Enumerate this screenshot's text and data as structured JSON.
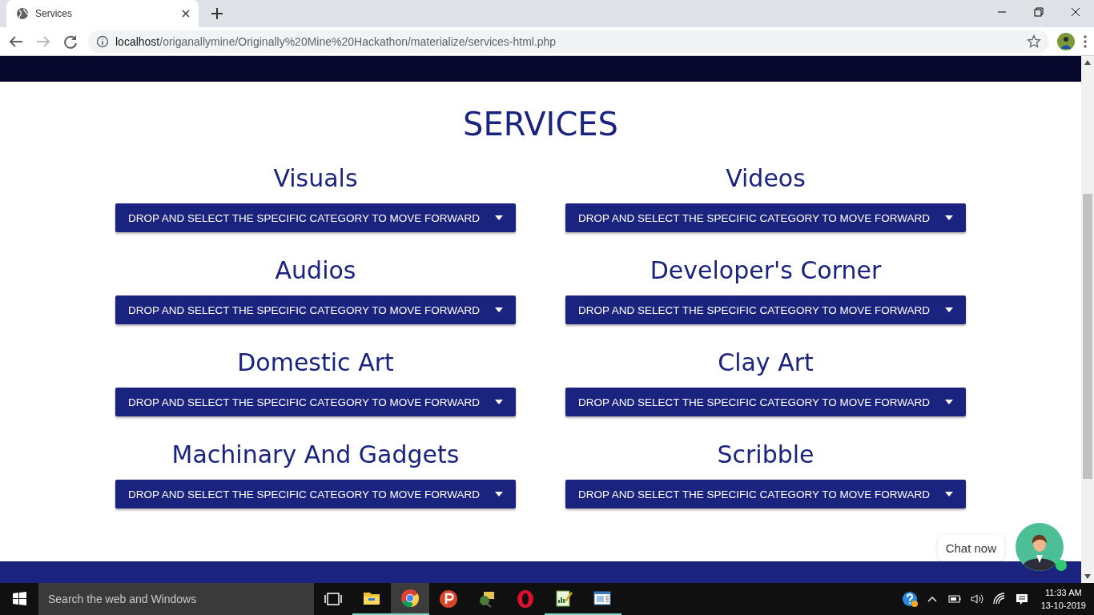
{
  "browser": {
    "tab": {
      "title": "Services"
    },
    "url": {
      "host": "localhost",
      "path": "/origanallymine/Originally%20Mine%20Hackathon/materialize/services-html.php"
    }
  },
  "page": {
    "title": "SERVICES",
    "services": [
      {
        "title": "Visuals",
        "dropdown": "DROP AND SELECT THE SPECIFIC CATEGORY TO MOVE FORWARD"
      },
      {
        "title": "Videos",
        "dropdown": "DROP AND SELECT THE SPECIFIC CATEGORY TO MOVE FORWARD"
      },
      {
        "title": "Audios",
        "dropdown": "DROP AND SELECT THE SPECIFIC CATEGORY TO MOVE FORWARD"
      },
      {
        "title": "Developer's Corner",
        "dropdown": "DROP AND SELECT THE SPECIFIC CATEGORY TO MOVE FORWARD"
      },
      {
        "title": "Domestic Art",
        "dropdown": "DROP AND SELECT THE SPECIFIC CATEGORY TO MOVE FORWARD"
      },
      {
        "title": "Clay Art",
        "dropdown": "DROP AND SELECT THE SPECIFIC CATEGORY TO MOVE FORWARD"
      },
      {
        "title": "Machinary And Gadgets",
        "dropdown": "DROP AND SELECT THE SPECIFIC CATEGORY TO MOVE FORWARD"
      },
      {
        "title": "Scribble",
        "dropdown": "DROP AND SELECT THE SPECIFIC CATEGORY TO MOVE FORWARD"
      }
    ],
    "chat": {
      "label": "Chat now",
      "online": true
    }
  },
  "taskbar": {
    "search": {
      "placeholder": "Search the web and Windows"
    },
    "apps": [
      {
        "kind": "task-view",
        "running": false,
        "selected": false
      },
      {
        "kind": "folder",
        "running": true,
        "selected": false
      },
      {
        "kind": "chrome",
        "running": true,
        "selected": true
      },
      {
        "kind": "psiphon",
        "running": false,
        "selected": false
      },
      {
        "kind": "mail-globe",
        "running": false,
        "selected": false
      },
      {
        "kind": "opera",
        "running": false,
        "selected": false
      },
      {
        "kind": "chart",
        "running": true,
        "selected": false
      },
      {
        "kind": "window",
        "running": true,
        "selected": false
      }
    ],
    "time": "11:33 AM",
    "date": "13-10-2019"
  }
}
